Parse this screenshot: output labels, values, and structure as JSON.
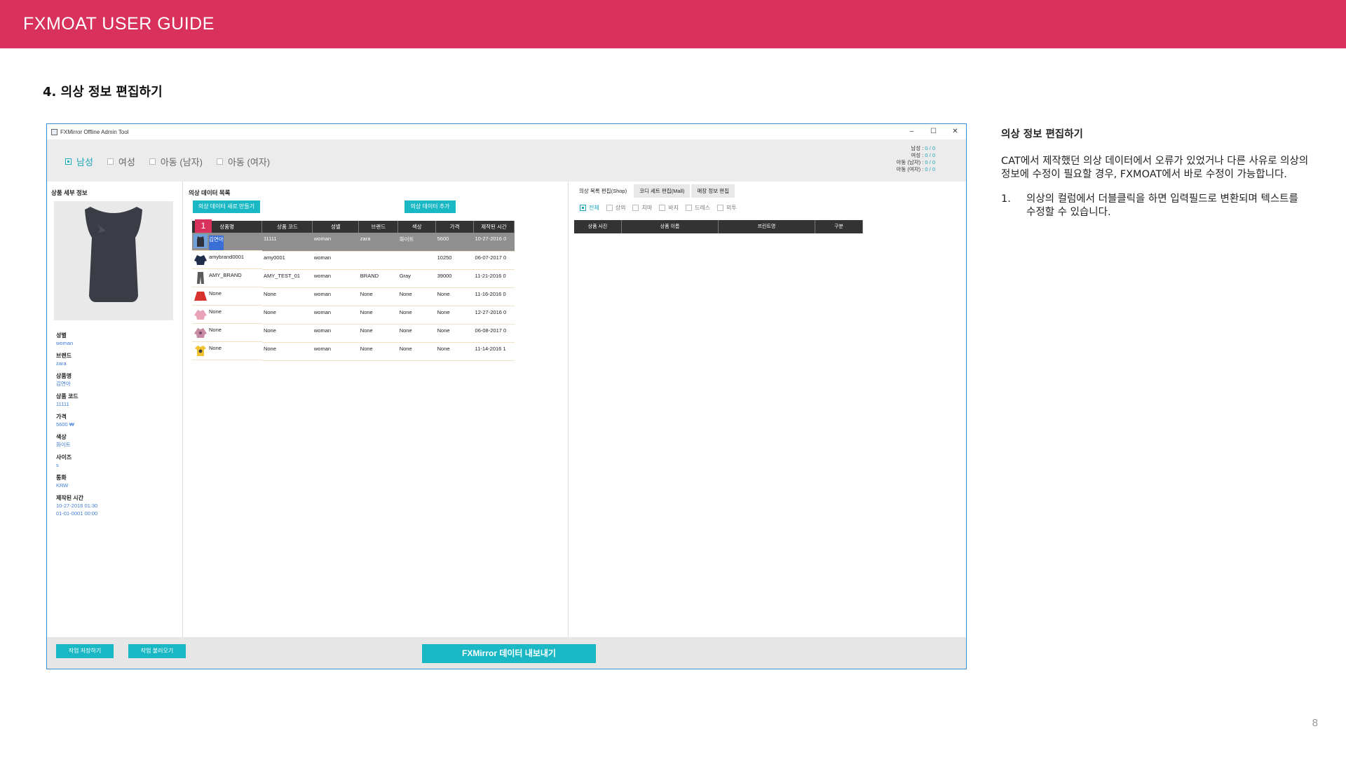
{
  "banner": {
    "title": "FXMOAT USER GUIDE"
  },
  "section": {
    "heading": "4. 의상 정보 편집하기"
  },
  "page_number": "8",
  "app": {
    "window_title": "FXMirror Offline Admin Tool",
    "window_controls": [
      "–",
      "☐",
      "✕"
    ],
    "gender_options": [
      {
        "label": "남성",
        "active": true
      },
      {
        "label": "여성",
        "active": false
      },
      {
        "label": "아동 (남자)",
        "active": false
      },
      {
        "label": "아동 (여자)",
        "active": false
      }
    ],
    "counts": [
      {
        "label": "남성",
        "value": "0 / 0"
      },
      {
        "label": "여성",
        "value": "0 / 0"
      },
      {
        "label": "아동 (남자)",
        "value": "0 / 0"
      },
      {
        "label": "아동 (여자)",
        "value": "0 / 0"
      }
    ],
    "detail": {
      "title": "상품 세부 정보",
      "fields": [
        {
          "label": "성별",
          "value": "woman"
        },
        {
          "label": "브랜드",
          "value": "zara"
        },
        {
          "label": "상품명",
          "value": "김연아"
        },
        {
          "label": "상품 코드",
          "value": "11111"
        },
        {
          "label": "가격",
          "value": "5600 ₩"
        },
        {
          "label": "색상",
          "value": "화이트"
        },
        {
          "label": "사이즈",
          "value": "s"
        },
        {
          "label": "통화",
          "value": "KRW"
        },
        {
          "label": "제작된 시간",
          "value": "10-27-2016 01:30"
        }
      ],
      "extra_value": "01-01-0001 00:00"
    },
    "list": {
      "title": "의상 데이터 목록",
      "new_button": "의상 데이터 새로 만들기",
      "add_button": "의상 데이터 추가",
      "badge": "1",
      "columns": [
        "상품명",
        "상품 코드",
        "성별",
        "브랜드",
        "색상",
        "가격",
        "제작된 시간"
      ],
      "rows": [
        {
          "name": "김연아",
          "code": "11111",
          "gender": "woman",
          "brand": "zara",
          "color": "화이트",
          "price": "5600",
          "time": "10-27-2016 0",
          "thumb": "sleeveless-top",
          "selected": true
        },
        {
          "name": "amybrand0001",
          "code": "amy0001",
          "gender": "woman",
          "brand": "",
          "color": "",
          "price": "10250",
          "time": "06-07-2017 0",
          "thumb": "navy-jacket",
          "selected": false
        },
        {
          "name": "AMY_BRAND",
          "code": "AMY_TEST_01",
          "gender": "woman",
          "brand": "BRAND",
          "color": "Gray",
          "price": "39000",
          "time": "11-21-2016 0",
          "thumb": "gray-pants",
          "selected": false
        },
        {
          "name": "None",
          "code": "None",
          "gender": "woman",
          "brand": "None",
          "color": "None",
          "price": "None",
          "time": "11-16-2016 0",
          "thumb": "red-skirt",
          "selected": false
        },
        {
          "name": "None",
          "code": "None",
          "gender": "woman",
          "brand": "None",
          "color": "None",
          "price": "None",
          "time": "12-27-2016 0",
          "thumb": "pink-top",
          "selected": false
        },
        {
          "name": "None",
          "code": "None",
          "gender": "woman",
          "brand": "None",
          "color": "None",
          "price": "None",
          "time": "06-08-2017 0",
          "thumb": "patterned-top",
          "selected": false
        },
        {
          "name": "None",
          "code": "None",
          "gender": "woman",
          "brand": "None",
          "color": "None",
          "price": "None",
          "time": "11-14-2016 1",
          "thumb": "yellow-tshirt",
          "selected": false
        }
      ]
    },
    "right": {
      "tabs": [
        "의상 목록 편집(Shop)",
        "코디 세트 편집(Mall)",
        "매장 정보 편집"
      ],
      "filters": [
        {
          "label": "전체",
          "active": true
        },
        {
          "label": "상의",
          "active": false
        },
        {
          "label": "치마",
          "active": false
        },
        {
          "label": "바지",
          "active": false
        },
        {
          "label": "드레스",
          "active": false
        },
        {
          "label": "외투",
          "active": false
        }
      ],
      "columns": [
        "상품 사진",
        "상품 이름",
        "프린트명",
        "구분"
      ]
    },
    "bottom": {
      "save_button": "작업 저장하기",
      "load_button": "작업 불러오기",
      "export_button": "FXMirror 데이터 내보내기"
    }
  },
  "description": {
    "title": "의상 정보 편집하기",
    "body": "CAT에서 제작했던 의상 데이터에서 오류가 있었거나 다른 사유로 의상의 정보에 수정이 필요할 경우, FXMOAT에서 바로 수정이 가능합니다.",
    "steps": [
      {
        "num": "1.",
        "text": "의상의 컬럼에서 더블클릭을 하면 입력필드로 변환되며 텍스트를 수정할 수 있습니다."
      }
    ]
  }
}
